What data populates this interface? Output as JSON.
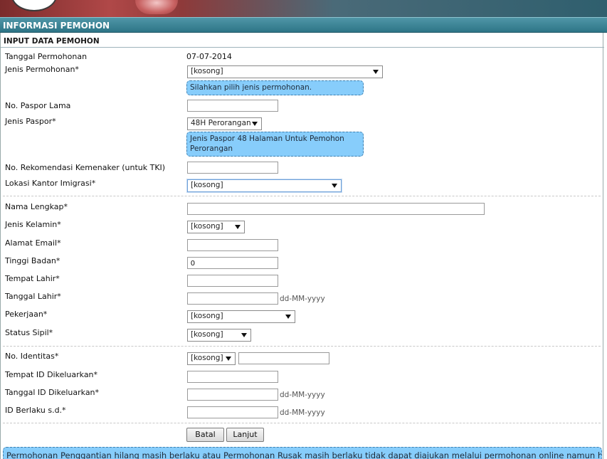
{
  "section_title": "INFORMASI PEMOHON",
  "subheader": "INPUT DATA PEMOHON",
  "form": {
    "tanggal_permohonan": {
      "label": "Tanggal Permohonan",
      "value": "07-07-2014"
    },
    "jenis_permohonan": {
      "label": "Jenis Permohonan*",
      "selected": "[kosong]",
      "info": "Silahkan pilih jenis permohonan."
    },
    "no_paspor_lama": {
      "label": "No. Paspor Lama",
      "value": ""
    },
    "jenis_paspor": {
      "label": "Jenis Paspor*",
      "selected": "48H Perorangan",
      "info_line1": "Jenis Paspor 48 Halaman Untuk Pemohon",
      "info_line2": "Perorangan"
    },
    "no_rekomendasi": {
      "label": "No. Rekomendasi Kemenaker (untuk TKI)",
      "value": ""
    },
    "lokasi_kantor": {
      "label": "Lokasi Kantor Imigrasi*",
      "selected": "[kosong]"
    },
    "nama_lengkap": {
      "label": "Nama Lengkap*",
      "value": ""
    },
    "jenis_kelamin": {
      "label": "Jenis Kelamin*",
      "selected": "[kosong]"
    },
    "alamat_email": {
      "label": "Alamat Email*",
      "value": ""
    },
    "tinggi_badan": {
      "label": "Tinggi Badan*",
      "value": "0"
    },
    "tempat_lahir": {
      "label": "Tempat Lahir*",
      "value": ""
    },
    "tanggal_lahir": {
      "label": "Tanggal Lahir*",
      "value": "",
      "hint": "dd-MM-yyyy"
    },
    "pekerjaan": {
      "label": "Pekerjaan*",
      "selected": "[kosong]"
    },
    "status_sipil": {
      "label": "Status Sipil*",
      "selected": "[kosong]"
    },
    "no_identitas": {
      "label": "No. Identitas*",
      "selected": "[kosong]",
      "value": ""
    },
    "tempat_id": {
      "label": "Tempat ID Dikeluarkan*",
      "value": ""
    },
    "tanggal_id": {
      "label": "Tanggal ID Dikeluarkan*",
      "value": "",
      "hint": "dd-MM-yyyy"
    },
    "id_berlaku": {
      "label": "ID Berlaku s.d.*",
      "value": "",
      "hint": "dd-MM-yyyy"
    }
  },
  "buttons": {
    "batal": "Batal",
    "lanjut": "Lanjut"
  },
  "notice": "Permohonan Penggantian hilang masih berlaku atau Permohonan Rusak masih berlaku tidak dapat diajukan melalui permohonan online namun harus"
}
